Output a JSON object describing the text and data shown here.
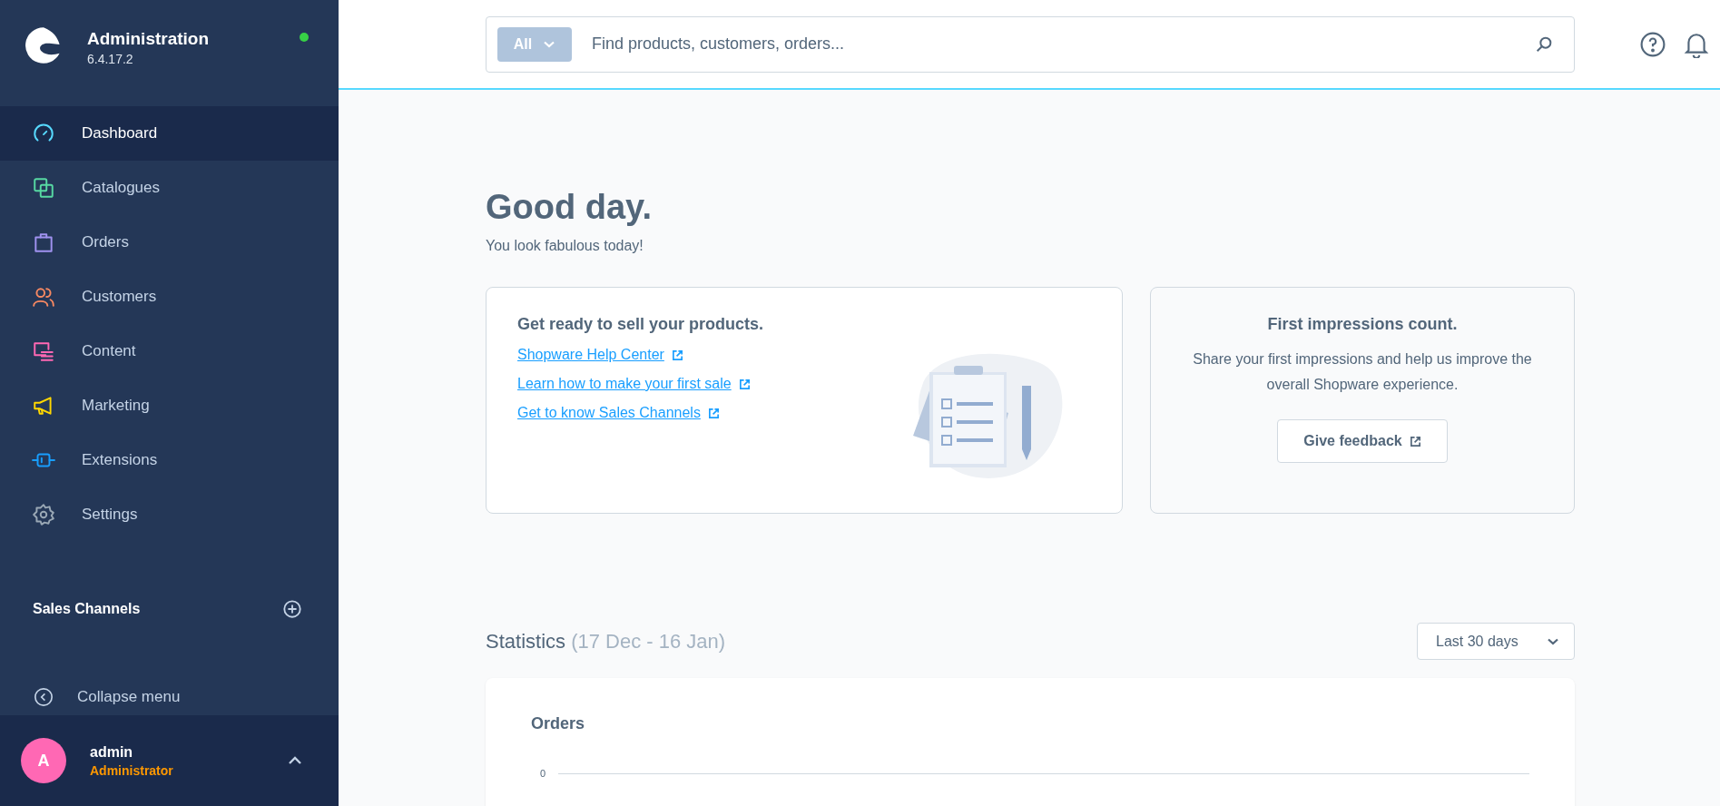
{
  "sidebar": {
    "app_title": "Administration",
    "version": "6.4.17.2",
    "online": true,
    "items": [
      {
        "label": "Dashboard",
        "selected": true,
        "color": "#57d9ff"
      },
      {
        "label": "Catalogues",
        "selected": false,
        "color": "#57d9a3"
      },
      {
        "label": "Orders",
        "selected": false,
        "color": "#a092f0"
      },
      {
        "label": "Customers",
        "selected": false,
        "color": "#f88962"
      },
      {
        "label": "Content",
        "selected": false,
        "color": "#ff68b4"
      },
      {
        "label": "Marketing",
        "selected": false,
        "color": "#ffd700"
      },
      {
        "label": "Extensions",
        "selected": false,
        "color": "#189eff"
      },
      {
        "label": "Settings",
        "selected": false,
        "color": "#9aa8b5"
      }
    ],
    "sales_channels": {
      "label": "Sales Channels"
    },
    "collapse": {
      "label": "Collapse menu"
    },
    "user": {
      "initial": "A",
      "name": "admin",
      "role": "Administrator"
    }
  },
  "search": {
    "scope": "All",
    "placeholder": "Find products, customers, orders..."
  },
  "greeting": {
    "title": "Good day.",
    "subtitle": "You look fabulous today!"
  },
  "getting_started": {
    "title": "Get ready to sell your products.",
    "links": [
      "Shopware Help Center",
      "Learn how to make your first sale",
      "Get to know Sales Channels"
    ]
  },
  "feedback": {
    "title": "First impressions count.",
    "text": "Share your first impressions and help us improve the overall Shopware experience.",
    "button": "Give feedback"
  },
  "statistics": {
    "title": "Statistics",
    "range": "(17 Dec - 16 Jan)",
    "period": "Last 30 days",
    "chart_title": "Orders",
    "y_tick": "0"
  }
}
